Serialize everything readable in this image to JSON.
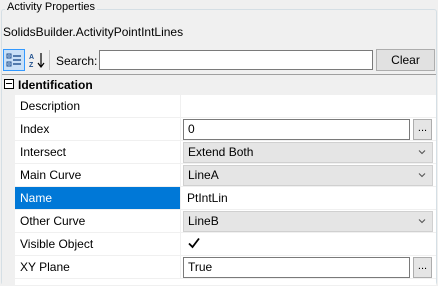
{
  "panel": {
    "title": "Activity Properties",
    "object_name": "SolidsBuilder.ActivityPointIntLines"
  },
  "toolbar": {
    "categorized_icon": "categorized-icon",
    "alphabetical_icon": "alphabetical-sort-icon",
    "search_label": "Search:",
    "search_value": "",
    "clear_label": "Clear"
  },
  "grid": {
    "category": "Identification",
    "rows": [
      {
        "name": "Description",
        "value": "",
        "editor": "text"
      },
      {
        "name": "Index",
        "value": "0",
        "editor": "ellipsis"
      },
      {
        "name": "Intersect",
        "value": "Extend Both",
        "editor": "combo"
      },
      {
        "name": "Main Curve",
        "value": "LineA",
        "editor": "combo"
      },
      {
        "name": "Name",
        "value": "PtIntLin",
        "editor": "text",
        "selected": true
      },
      {
        "name": "Other Curve",
        "value": "LineB",
        "editor": "combo"
      },
      {
        "name": "Visible Object",
        "value": "checked",
        "editor": "checkbox"
      },
      {
        "name": "XY Plane",
        "value": "True",
        "editor": "ellipsis"
      }
    ]
  },
  "colors": {
    "selection": "#0078d7",
    "grid_line": "#f0f0f0",
    "background": "#f0f0f0"
  }
}
